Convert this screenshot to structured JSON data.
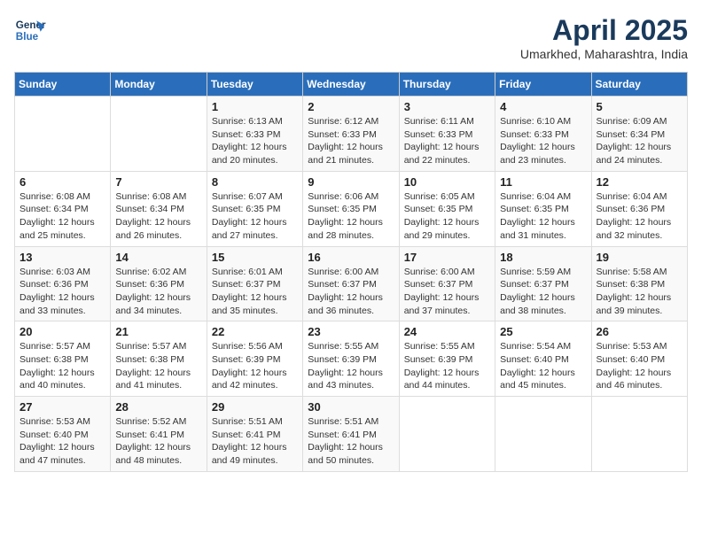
{
  "header": {
    "logo_line1": "General",
    "logo_line2": "Blue",
    "month": "April 2025",
    "location": "Umarkhed, Maharashtra, India"
  },
  "days_of_week": [
    "Sunday",
    "Monday",
    "Tuesday",
    "Wednesday",
    "Thursday",
    "Friday",
    "Saturday"
  ],
  "weeks": [
    [
      null,
      null,
      {
        "day": "1",
        "sunrise": "Sunrise: 6:13 AM",
        "sunset": "Sunset: 6:33 PM",
        "daylight": "Daylight: 12 hours and 20 minutes."
      },
      {
        "day": "2",
        "sunrise": "Sunrise: 6:12 AM",
        "sunset": "Sunset: 6:33 PM",
        "daylight": "Daylight: 12 hours and 21 minutes."
      },
      {
        "day": "3",
        "sunrise": "Sunrise: 6:11 AM",
        "sunset": "Sunset: 6:33 PM",
        "daylight": "Daylight: 12 hours and 22 minutes."
      },
      {
        "day": "4",
        "sunrise": "Sunrise: 6:10 AM",
        "sunset": "Sunset: 6:33 PM",
        "daylight": "Daylight: 12 hours and 23 minutes."
      },
      {
        "day": "5",
        "sunrise": "Sunrise: 6:09 AM",
        "sunset": "Sunset: 6:34 PM",
        "daylight": "Daylight: 12 hours and 24 minutes."
      }
    ],
    [
      {
        "day": "6",
        "sunrise": "Sunrise: 6:08 AM",
        "sunset": "Sunset: 6:34 PM",
        "daylight": "Daylight: 12 hours and 25 minutes."
      },
      {
        "day": "7",
        "sunrise": "Sunrise: 6:08 AM",
        "sunset": "Sunset: 6:34 PM",
        "daylight": "Daylight: 12 hours and 26 minutes."
      },
      {
        "day": "8",
        "sunrise": "Sunrise: 6:07 AM",
        "sunset": "Sunset: 6:35 PM",
        "daylight": "Daylight: 12 hours and 27 minutes."
      },
      {
        "day": "9",
        "sunrise": "Sunrise: 6:06 AM",
        "sunset": "Sunset: 6:35 PM",
        "daylight": "Daylight: 12 hours and 28 minutes."
      },
      {
        "day": "10",
        "sunrise": "Sunrise: 6:05 AM",
        "sunset": "Sunset: 6:35 PM",
        "daylight": "Daylight: 12 hours and 29 minutes."
      },
      {
        "day": "11",
        "sunrise": "Sunrise: 6:04 AM",
        "sunset": "Sunset: 6:35 PM",
        "daylight": "Daylight: 12 hours and 31 minutes."
      },
      {
        "day": "12",
        "sunrise": "Sunrise: 6:04 AM",
        "sunset": "Sunset: 6:36 PM",
        "daylight": "Daylight: 12 hours and 32 minutes."
      }
    ],
    [
      {
        "day": "13",
        "sunrise": "Sunrise: 6:03 AM",
        "sunset": "Sunset: 6:36 PM",
        "daylight": "Daylight: 12 hours and 33 minutes."
      },
      {
        "day": "14",
        "sunrise": "Sunrise: 6:02 AM",
        "sunset": "Sunset: 6:36 PM",
        "daylight": "Daylight: 12 hours and 34 minutes."
      },
      {
        "day": "15",
        "sunrise": "Sunrise: 6:01 AM",
        "sunset": "Sunset: 6:37 PM",
        "daylight": "Daylight: 12 hours and 35 minutes."
      },
      {
        "day": "16",
        "sunrise": "Sunrise: 6:00 AM",
        "sunset": "Sunset: 6:37 PM",
        "daylight": "Daylight: 12 hours and 36 minutes."
      },
      {
        "day": "17",
        "sunrise": "Sunrise: 6:00 AM",
        "sunset": "Sunset: 6:37 PM",
        "daylight": "Daylight: 12 hours and 37 minutes."
      },
      {
        "day": "18",
        "sunrise": "Sunrise: 5:59 AM",
        "sunset": "Sunset: 6:37 PM",
        "daylight": "Daylight: 12 hours and 38 minutes."
      },
      {
        "day": "19",
        "sunrise": "Sunrise: 5:58 AM",
        "sunset": "Sunset: 6:38 PM",
        "daylight": "Daylight: 12 hours and 39 minutes."
      }
    ],
    [
      {
        "day": "20",
        "sunrise": "Sunrise: 5:57 AM",
        "sunset": "Sunset: 6:38 PM",
        "daylight": "Daylight: 12 hours and 40 minutes."
      },
      {
        "day": "21",
        "sunrise": "Sunrise: 5:57 AM",
        "sunset": "Sunset: 6:38 PM",
        "daylight": "Daylight: 12 hours and 41 minutes."
      },
      {
        "day": "22",
        "sunrise": "Sunrise: 5:56 AM",
        "sunset": "Sunset: 6:39 PM",
        "daylight": "Daylight: 12 hours and 42 minutes."
      },
      {
        "day": "23",
        "sunrise": "Sunrise: 5:55 AM",
        "sunset": "Sunset: 6:39 PM",
        "daylight": "Daylight: 12 hours and 43 minutes."
      },
      {
        "day": "24",
        "sunrise": "Sunrise: 5:55 AM",
        "sunset": "Sunset: 6:39 PM",
        "daylight": "Daylight: 12 hours and 44 minutes."
      },
      {
        "day": "25",
        "sunrise": "Sunrise: 5:54 AM",
        "sunset": "Sunset: 6:40 PM",
        "daylight": "Daylight: 12 hours and 45 minutes."
      },
      {
        "day": "26",
        "sunrise": "Sunrise: 5:53 AM",
        "sunset": "Sunset: 6:40 PM",
        "daylight": "Daylight: 12 hours and 46 minutes."
      }
    ],
    [
      {
        "day": "27",
        "sunrise": "Sunrise: 5:53 AM",
        "sunset": "Sunset: 6:40 PM",
        "daylight": "Daylight: 12 hours and 47 minutes."
      },
      {
        "day": "28",
        "sunrise": "Sunrise: 5:52 AM",
        "sunset": "Sunset: 6:41 PM",
        "daylight": "Daylight: 12 hours and 48 minutes."
      },
      {
        "day": "29",
        "sunrise": "Sunrise: 5:51 AM",
        "sunset": "Sunset: 6:41 PM",
        "daylight": "Daylight: 12 hours and 49 minutes."
      },
      {
        "day": "30",
        "sunrise": "Sunrise: 5:51 AM",
        "sunset": "Sunset: 6:41 PM",
        "daylight": "Daylight: 12 hours and 50 minutes."
      },
      null,
      null,
      null
    ]
  ]
}
